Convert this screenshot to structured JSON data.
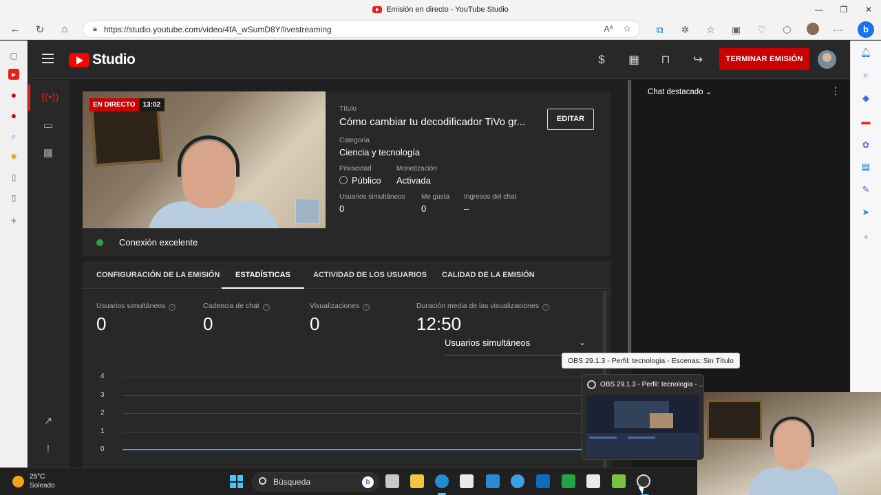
{
  "window": {
    "title": "Emisión en directo - YouTube Studio",
    "url": "https://studio.youtube.com/video/4fA_wSumD8Y/livestreaming"
  },
  "header": {
    "logo_text": "Studio",
    "end_button": "TERMINAR EMISIÓN"
  },
  "video": {
    "live_label": "EN DIRECTO",
    "elapsed": "13:02"
  },
  "connection": "Conexión excelente",
  "details": {
    "title_label": "Título",
    "title": "Cómo cambiar tu decodificador TiVo gr...",
    "edit_button": "EDITAR",
    "category_label": "Categoría",
    "category": "Ciencia y tecnología",
    "privacy_label": "Privacidad",
    "privacy": "Público",
    "monetization_label": "Monetización",
    "monetization": "Activada",
    "concurrent_label": "Usuarios simultáneos",
    "concurrent": "0",
    "likes_label": "Me gusta",
    "likes": "0",
    "chat_revenue_label": "Ingresos del chat",
    "chat_revenue": "–"
  },
  "tabs": [
    {
      "label": "CONFIGURACIÓN DE LA EMISIÓN"
    },
    {
      "label": "ESTADÍSTICAS"
    },
    {
      "label": "ACTIVIDAD DE LOS USUARIOS"
    },
    {
      "label": "CALIDAD DE LA EMISIÓN"
    }
  ],
  "stats": [
    {
      "label": "Usuarios simultáneos",
      "value": "0"
    },
    {
      "label": "Cadencia de chat",
      "value": "0"
    },
    {
      "label": "Visualizaciones",
      "value": "0"
    },
    {
      "label": "Duración media de las visualizaciones",
      "value": "12:50"
    }
  ],
  "metric_select": "Usuarios simultáneos",
  "chart_data": {
    "type": "line",
    "title": "",
    "xlabel": "",
    "ylabel": "",
    "ylim": [
      0,
      4
    ],
    "yticks": [
      "4",
      "3",
      "2",
      "1",
      "0"
    ],
    "series": [
      {
        "values": [
          0,
          0
        ]
      }
    ],
    "color": "#3ea6ff"
  },
  "chat": {
    "header": "Chat destacado"
  },
  "tooltip": "OBS 29.1.3 - Perfil: tecnologia - Escenas: Sin Título",
  "preview_title": "OBS 29.1.3 - Perfil: tecnologia - ...",
  "taskbar": {
    "temperature": "25°C",
    "weather": "Soleado",
    "search": "Búsqueda"
  },
  "colors": {
    "accent_red": "#cc0000",
    "status_green": "#2ba640",
    "chart_blue": "#3ea6ff"
  }
}
